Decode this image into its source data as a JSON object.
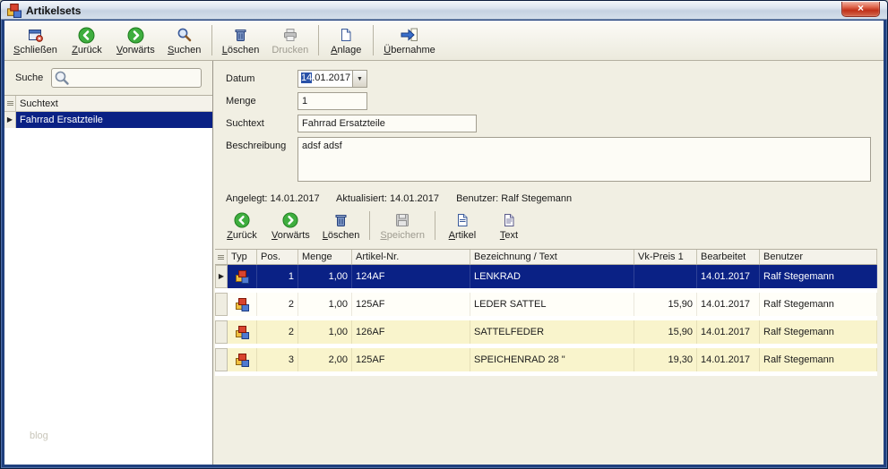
{
  "window": {
    "title": "Artikelsets"
  },
  "glyphs": {
    "close": "×",
    "dropdown": "▼",
    "row_marker": "▶"
  },
  "colors": {
    "selection": "#0a2185",
    "alt_row": "#f9f4cc",
    "frame": "#20407e",
    "close_button": "#c03018"
  },
  "main_toolbar": {
    "buttons": [
      {
        "label": "Schließen",
        "icon": "close-window-icon",
        "enabled": true
      },
      {
        "label": "Zurück",
        "icon": "back-icon",
        "enabled": true
      },
      {
        "label": "Vorwärts",
        "icon": "forward-icon",
        "enabled": true
      },
      {
        "label": "Suchen",
        "icon": "search-icon",
        "enabled": true
      },
      {
        "label": "Löschen",
        "icon": "trash-icon",
        "enabled": true
      },
      {
        "label": "Drucken",
        "icon": "printer-icon",
        "enabled": false
      },
      {
        "label": "Anlage",
        "icon": "new-document-icon",
        "enabled": true
      },
      {
        "label": "Übernahme",
        "icon": "transfer-icon",
        "enabled": true
      }
    ]
  },
  "sidebar": {
    "search_label": "Suche",
    "search_value": "",
    "list_header": "Suchtext",
    "items": [
      {
        "label": "Fahrrad Ersatzteile",
        "selected": true
      }
    ],
    "watermark": "blog"
  },
  "form": {
    "datum_label": "Datum",
    "datum_value": "14.01.2017",
    "datum_selected_part": "14",
    "datum_rest_part": ".01.2017",
    "menge_label": "Menge",
    "menge_value": "1",
    "suchtext_label": "Suchtext",
    "suchtext_value": "Fahrrad Ersatzteile",
    "beschreibung_label": "Beschreibung",
    "beschreibung_value": "adsf adsf",
    "status": {
      "angelegt": "Angelegt: 14.01.2017",
      "aktualisiert": "Aktualisiert: 14.01.2017",
      "benutzer": "Benutzer: Ralf Stegemann"
    }
  },
  "detail_toolbar": {
    "buttons": [
      {
        "label": "Zurück",
        "icon": "back-icon",
        "enabled": true
      },
      {
        "label": "Vorwärts",
        "icon": "forward-icon",
        "enabled": true
      },
      {
        "label": "Löschen",
        "icon": "trash-icon",
        "enabled": true
      },
      {
        "label": "Speichern",
        "icon": "save-icon",
        "enabled": false
      },
      {
        "label": "Artikel",
        "icon": "article-icon",
        "enabled": true
      },
      {
        "label": "Text",
        "icon": "text-icon",
        "enabled": true
      }
    ]
  },
  "grid": {
    "columns": [
      "Typ",
      "Pos.",
      "Menge",
      "Artikel-Nr.",
      "Bezeichnung / Text",
      "Vk-Preis 1",
      "Bearbeitet",
      "Benutzer"
    ],
    "rows": [
      {
        "typ_icon": "article-icon",
        "pos": "1",
        "menge": "1,00",
        "artikel_nr": "124AF",
        "bezeichnung": "LENKRAD",
        "vk_preis": "",
        "bearbeitet": "14.01.2017",
        "benutzer": "Ralf Stegemann",
        "row_color": "selected"
      },
      {
        "typ_icon": "article-icon",
        "pos": "2",
        "menge": "1,00",
        "artikel_nr": "125AF",
        "bezeichnung": "LEDER SATTEL",
        "vk_preis": "15,90",
        "bearbeitet": "14.01.2017",
        "benutzer": "Ralf Stegemann",
        "row_color": "default"
      },
      {
        "typ_icon": "article-icon",
        "pos": "2",
        "menge": "1,00",
        "artikel_nr": "126AF",
        "bezeichnung": "SATTELFEDER",
        "vk_preis": "15,90",
        "bearbeitet": "14.01.2017",
        "benutzer": "Ralf Stegemann",
        "row_color": "alternate"
      },
      {
        "typ_icon": "article-icon",
        "pos": "3",
        "menge": "2,00",
        "artikel_nr": "125AF",
        "bezeichnung": "SPEICHENRAD 28 \"",
        "vk_preis": "19,30",
        "bearbeitet": "14.01.2017",
        "benutzer": "Ralf Stegemann",
        "row_color": "alternate"
      }
    ]
  }
}
